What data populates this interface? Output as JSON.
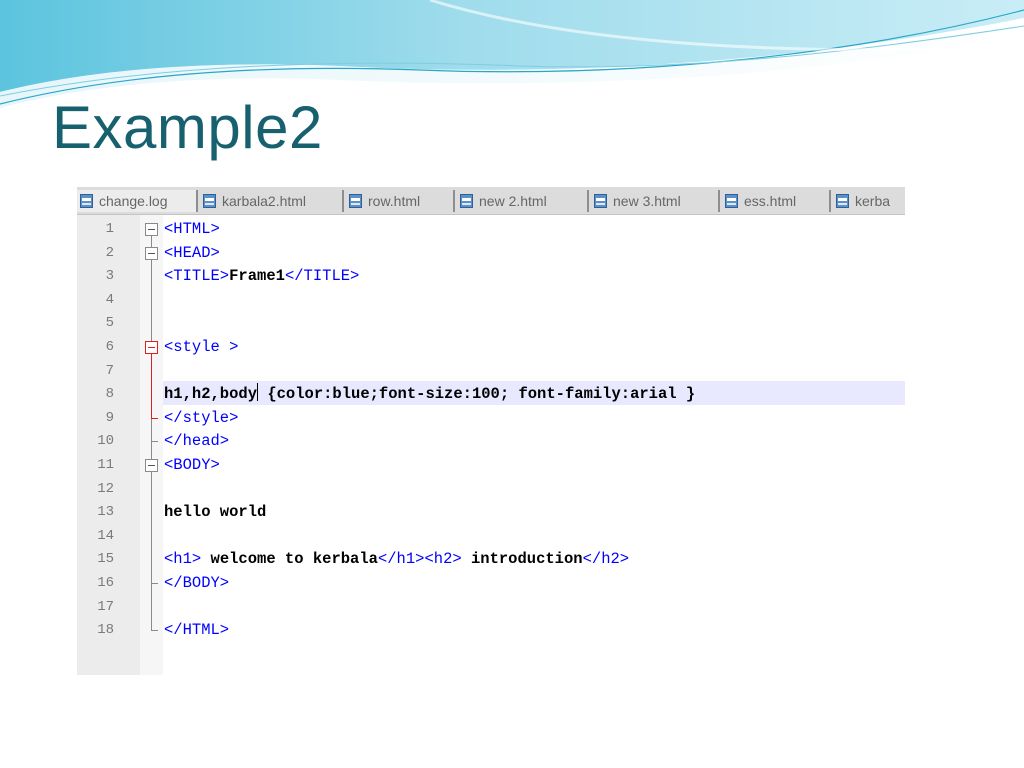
{
  "slide": {
    "title": "Example2"
  },
  "editor": {
    "tabs": [
      {
        "label": "change.log",
        "active": true
      },
      {
        "label": "karbala2.html",
        "active": false
      },
      {
        "label": "row.html",
        "active": false
      },
      {
        "label": "new  2.html",
        "active": false
      },
      {
        "label": "new 3.html",
        "active": false
      },
      {
        "label": "ess.html",
        "active": false
      },
      {
        "label": "kerba",
        "active": false
      }
    ],
    "current_line": 8,
    "lines": [
      {
        "num": "1",
        "tokens": [
          {
            "t": "tag",
            "v": "<HTML>"
          }
        ]
      },
      {
        "num": "2",
        "tokens": [
          {
            "t": "tag",
            "v": "<HEAD>"
          }
        ]
      },
      {
        "num": "3",
        "tokens": [
          {
            "t": "tag",
            "v": "<TITLE>"
          },
          {
            "t": "text",
            "v": "Frame1"
          },
          {
            "t": "tag",
            "v": "</TITLE>"
          }
        ]
      },
      {
        "num": "4",
        "tokens": []
      },
      {
        "num": "5",
        "tokens": []
      },
      {
        "num": "6",
        "tokens": [
          {
            "t": "tag",
            "v": "<style >"
          }
        ]
      },
      {
        "num": "7",
        "tokens": []
      },
      {
        "num": "8",
        "tokens": [
          {
            "t": "text",
            "v": "h1,h2,body"
          },
          {
            "t": "caret",
            "v": ""
          },
          {
            "t": "text",
            "v": " {color:blue;font-size:100; font-family:arial }"
          }
        ]
      },
      {
        "num": "9",
        "tokens": [
          {
            "t": "tag",
            "v": "</style>"
          }
        ]
      },
      {
        "num": "10",
        "tokens": [
          {
            "t": "tag",
            "v": "</head>"
          }
        ]
      },
      {
        "num": "11",
        "tokens": [
          {
            "t": "tag",
            "v": "<BODY>"
          }
        ]
      },
      {
        "num": "12",
        "tokens": []
      },
      {
        "num": "13",
        "tokens": [
          {
            "t": "text",
            "v": "hello world"
          }
        ]
      },
      {
        "num": "14",
        "tokens": []
      },
      {
        "num": "15",
        "tokens": [
          {
            "t": "tag",
            "v": "<h1>"
          },
          {
            "t": "text",
            "v": " welcome to kerbala"
          },
          {
            "t": "tag",
            "v": "</h1><h2>"
          },
          {
            "t": "text",
            "v": " introduction"
          },
          {
            "t": "tag",
            "v": "</h2>"
          }
        ]
      },
      {
        "num": "16",
        "tokens": [
          {
            "t": "tag",
            "v": "</BODY>"
          }
        ]
      },
      {
        "num": "17",
        "tokens": []
      },
      {
        "num": "18",
        "tokens": [
          {
            "t": "tag",
            "v": "</HTML>"
          }
        ]
      }
    ]
  }
}
